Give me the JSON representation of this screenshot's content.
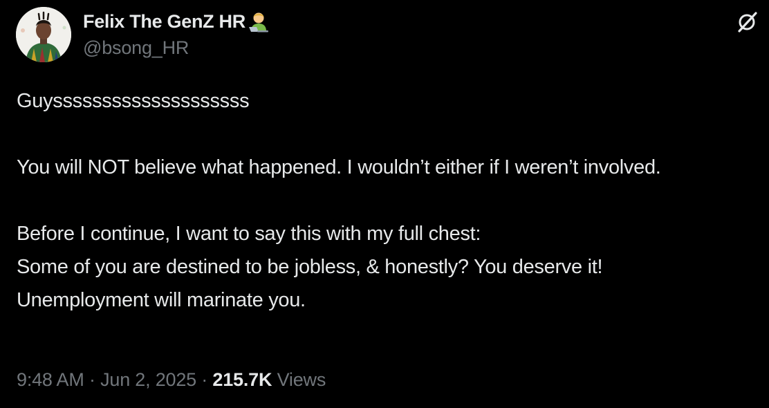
{
  "author": {
    "display_name": "Felix The GenZ HR",
    "emoji": "technologist-emoji",
    "handle": "@bsong_HR",
    "avatar_icon": "profile-photo"
  },
  "grok_icon": "grok-icon",
  "post": {
    "paragraphs": [
      "Guyssssssssssssssssssss",
      "",
      "You will NOT believe what happened. I wouldn’t either if I weren’t involved.",
      "",
      "Before I continue, I want to say this with my full chest:",
      "Some of you are destined to be jobless, & honestly? You deserve it!",
      "Unemployment will marinate you."
    ]
  },
  "meta": {
    "time": "9:48 AM",
    "separator1": " · ",
    "date": "Jun 2, 2025",
    "separator2": " · ",
    "views_count": "215.7K",
    "views_label": " Views"
  },
  "colors": {
    "background": "#000000",
    "primary_text": "#e7e9ea",
    "secondary_text": "#71767b"
  }
}
